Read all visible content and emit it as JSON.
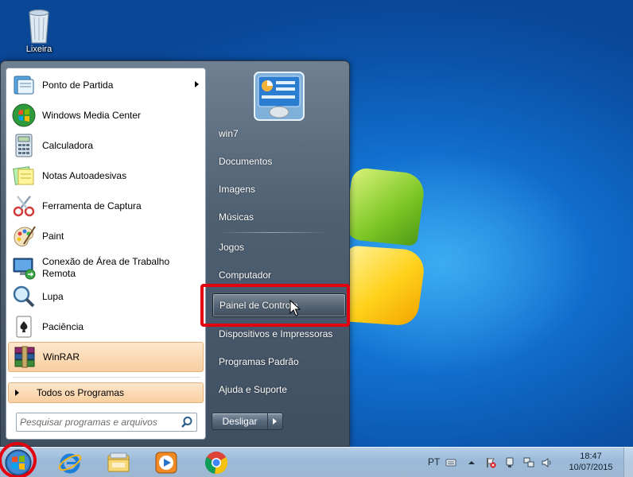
{
  "desktop": {
    "icons": [
      {
        "label": "Lixeira",
        "icon": "recycle-bin-icon"
      }
    ]
  },
  "start_menu": {
    "programs": [
      {
        "label": "Ponto de Partida",
        "icon": "getting-started-icon",
        "has_submenu": true
      },
      {
        "label": "Windows Media Center",
        "icon": "media-center-icon"
      },
      {
        "label": "Calculadora",
        "icon": "calculator-icon"
      },
      {
        "label": "Notas Autoadesivas",
        "icon": "sticky-notes-icon"
      },
      {
        "label": "Ferramenta de Captura",
        "icon": "snipping-tool-icon"
      },
      {
        "label": "Paint",
        "icon": "paint-icon"
      },
      {
        "label": "Conexão de Área de Trabalho Remota",
        "icon": "remote-desktop-icon"
      },
      {
        "label": "Lupa",
        "icon": "magnifier-icon"
      },
      {
        "label": "Paciência",
        "icon": "solitaire-icon"
      },
      {
        "label": "WinRAR",
        "icon": "winrar-icon",
        "highlighted": true
      }
    ],
    "all_programs": "Todos os Programas",
    "search_placeholder": "Pesquisar programas e arquivos",
    "right_items": [
      {
        "label": "win7"
      },
      {
        "label": "Documentos"
      },
      {
        "label": "Imagens"
      },
      {
        "label": "Músicas"
      },
      {
        "label": "Jogos"
      },
      {
        "label": "Computador"
      },
      {
        "label": "Painel de Controle",
        "highlighted": true
      },
      {
        "label": "Dispositivos e Impressoras"
      },
      {
        "label": "Programas Padrão"
      },
      {
        "label": "Ajuda e Suporte"
      }
    ],
    "shutdown_label": "Desligar"
  },
  "taskbar": {
    "pinned": [
      "internet-explorer-icon",
      "windows-explorer-icon",
      "media-player-icon",
      "chrome-icon"
    ],
    "tray": {
      "language": "PT",
      "time": "18:47",
      "date": "10/07/2015"
    }
  },
  "colors": {
    "annotation_red": "#e3000f",
    "highlight_orange": "#f8cfa0",
    "desktop_blue": "#1270cf"
  }
}
